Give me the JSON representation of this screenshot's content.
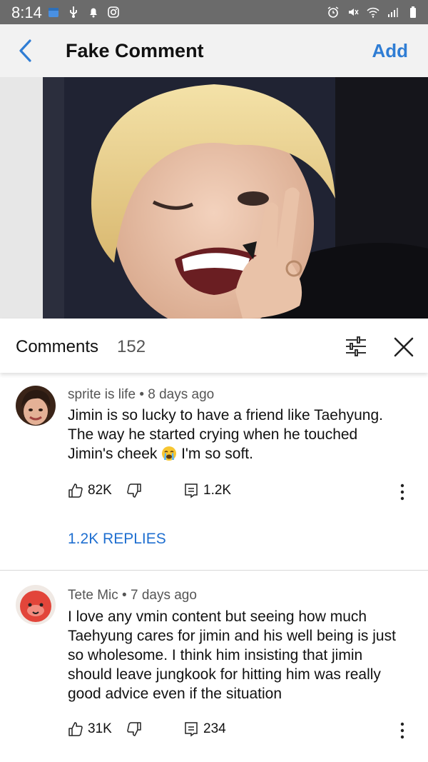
{
  "status_bar": {
    "time": "8:14",
    "left_icons": [
      "calendar-icon",
      "usb-icon",
      "notification-bell-icon",
      "instagram-icon"
    ],
    "right_icons": [
      "alarm-icon",
      "mute-icon",
      "wifi-icon",
      "signal-icon",
      "battery-icon"
    ]
  },
  "app_bar": {
    "back_icon": "chevron-left-icon",
    "title": "Fake Comment",
    "add_label": "Add",
    "accent_color": "#2f7dd4"
  },
  "header": {
    "title": "Comments",
    "count": "152",
    "sort_icon": "sort-filter-icon",
    "close_icon": "close-icon"
  },
  "comments": [
    {
      "author": "sprite is life",
      "separator": "•",
      "time": "8 days ago",
      "text_before_emoji": "Jimin is so lucky to have a friend like Taehyung. The way he started crying when he touched Jimin's cheek",
      "emoji": "crying-face-emoji",
      "text_after_emoji": " I'm so soft.",
      "likes": "82K",
      "replies_count": "1.2K",
      "replies_label": "1.2K REPLIES"
    },
    {
      "author": "Tete Mic",
      "separator": "•",
      "time": "7 days ago",
      "text": "I love any vmin content but seeing how much Taehyung cares for jimin and his well being is just so wholesome. I think him insisting that jimin should leave jungkook for hitting him was really good advice even if the situation",
      "likes": "31K",
      "replies_count": "234"
    }
  ],
  "reply_link_color": "#1f6fd0"
}
